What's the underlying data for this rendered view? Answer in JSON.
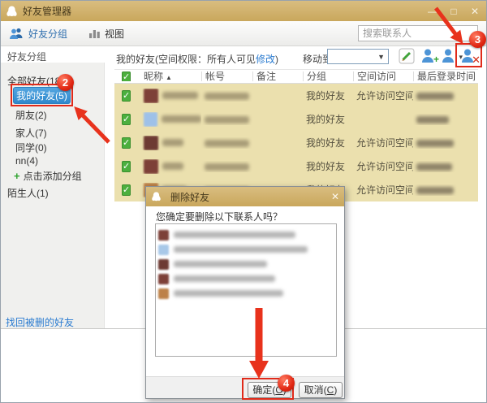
{
  "window": {
    "title": "好友管理器",
    "controls": {
      "minimize": "—",
      "maximize": "□",
      "close": "✕"
    }
  },
  "toolbar": {
    "groups_label": "好友分组",
    "view_label": "视图",
    "search_placeholder": "搜索联系人"
  },
  "sidebar": {
    "header": "好友分组",
    "items": [
      {
        "label": "全部好友(18)",
        "selected": false
      },
      {
        "label": "我的好友(5)",
        "selected": true
      },
      {
        "label": "朋友(2)",
        "selected": false
      },
      {
        "label": "家人(7)",
        "selected": false
      },
      {
        "label": "同学(0)",
        "selected": false
      },
      {
        "label": "nn(4)",
        "selected": false
      },
      {
        "label": "点击添加分组",
        "selected": false,
        "add_action": true
      },
      {
        "label": "陌生人(1)",
        "selected": false
      }
    ],
    "recover_link": "找回被删的好友"
  },
  "main": {
    "header_prefix": "我的好友(空间权限：所有人可见",
    "header_link": "修改",
    "header_suffix": ")",
    "move_to_label": "移动到",
    "table": {
      "columns": [
        "昵称",
        "帐号",
        "备注",
        "分组",
        "空间访问",
        "最后登录时间"
      ],
      "sort_arrow": "▲",
      "rows": [
        {
          "group": "我的好友",
          "space_access": "允许访问空间"
        },
        {
          "group": "我的好友",
          "space_access": ""
        },
        {
          "group": "我的好友",
          "space_access": "允许访问空间"
        },
        {
          "group": "我的好友",
          "space_access": "允许访问空间"
        },
        {
          "group": "我的好友",
          "space_access": "允许访问空间"
        }
      ],
      "avatars": [
        "#7d4038",
        "#9ec1e8",
        "#6d3a33",
        "#7d4038",
        "#bd8148"
      ]
    }
  },
  "dialog": {
    "title": "删除好友",
    "message": "您确定要删除以下联系人吗？",
    "avatars": [
      "#7d4038",
      "#a8c8e8",
      "#6d3a33",
      "#7d4038",
      "#bd8148"
    ],
    "ok_pre": "确定(",
    "ok_key": "O",
    "ok_post": ")",
    "cancel_pre": "取消(",
    "cancel_key": "C",
    "cancel_post": ")"
  },
  "annotations": {
    "step2": "2",
    "step3": "3",
    "step4": "4"
  },
  "icons": {
    "check": "✓",
    "dropdown": "▼",
    "plus": "+",
    "add_badge": "+",
    "drop_badge": "▾",
    "delete_badge": "✕",
    "dialog_close": "✕"
  },
  "colors": {
    "titlebar_gold": "#cfae67",
    "annotation_red": "#e8321c",
    "selection_blue": "#3898db",
    "row_khaki": "#ebe0ae",
    "link_blue": "#2a7bd0",
    "check_green": "#4caf3e"
  }
}
